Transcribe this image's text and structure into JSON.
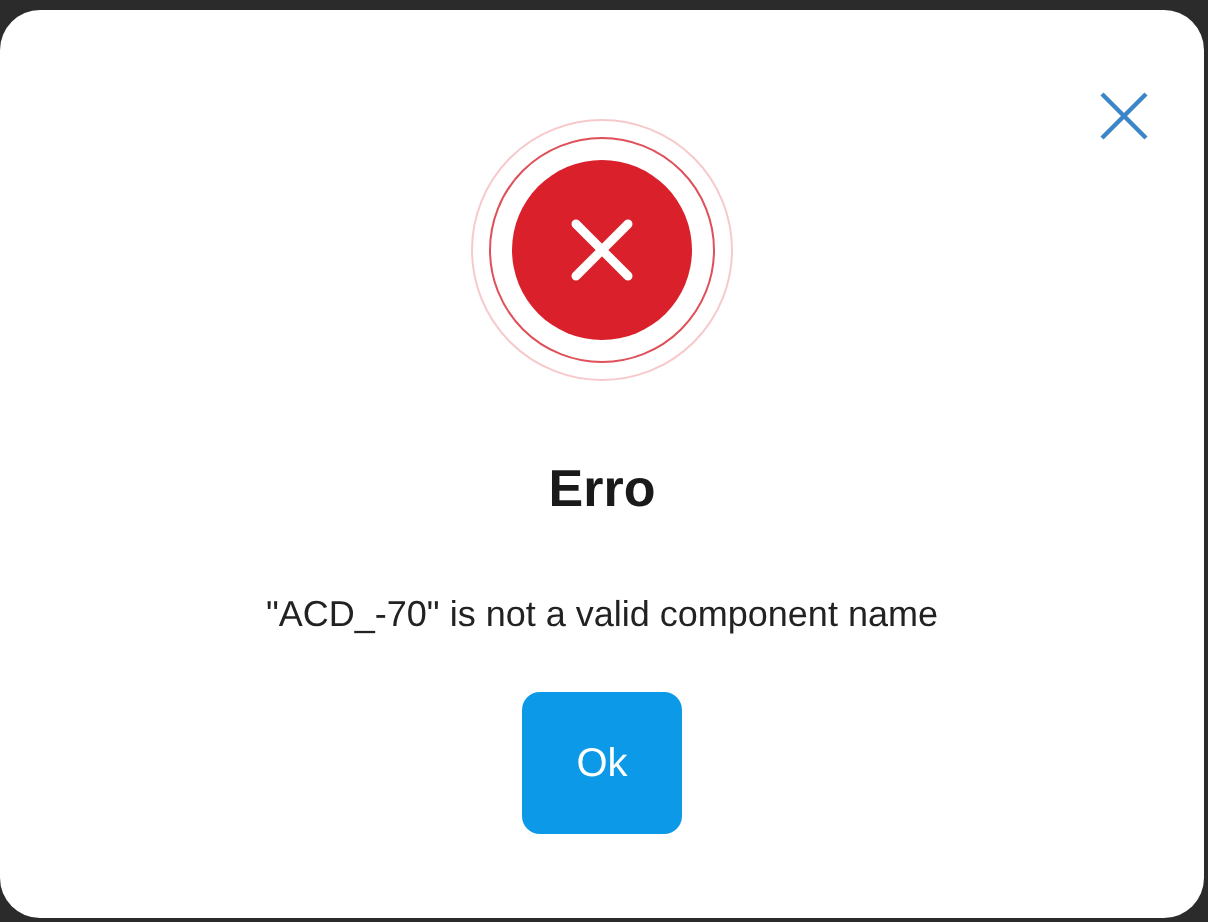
{
  "dialog": {
    "title": "Erro",
    "message": "\"ACD_-70\" is not a valid component name",
    "buttons": [
      "Ok"
    ]
  }
}
